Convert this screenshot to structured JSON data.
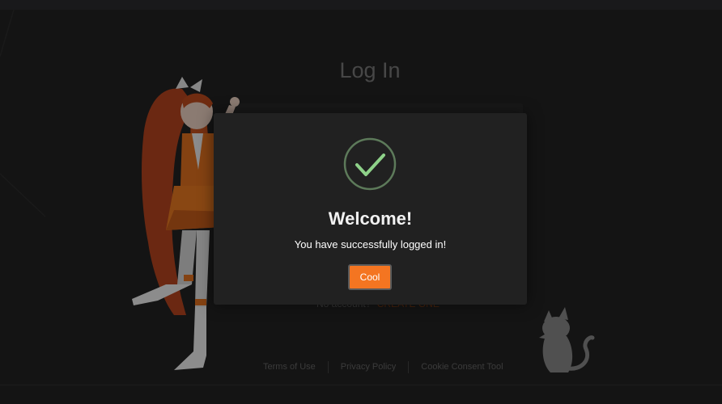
{
  "page": {
    "title": "Log In"
  },
  "login_form": {
    "no_account_text": "No account?",
    "create_link": "CREATE ONE"
  },
  "footer": {
    "links": [
      "Terms of Use",
      "Privacy Policy",
      "Cookie Consent Tool"
    ]
  },
  "modal": {
    "title": "Welcome!",
    "message": "You have successfully logged in!",
    "button_label": "Cool",
    "icon": "checkmark-icon"
  },
  "colors": {
    "accent": "#f47521",
    "check": "#8ed189",
    "background": "#232323",
    "modal": "#212121"
  }
}
